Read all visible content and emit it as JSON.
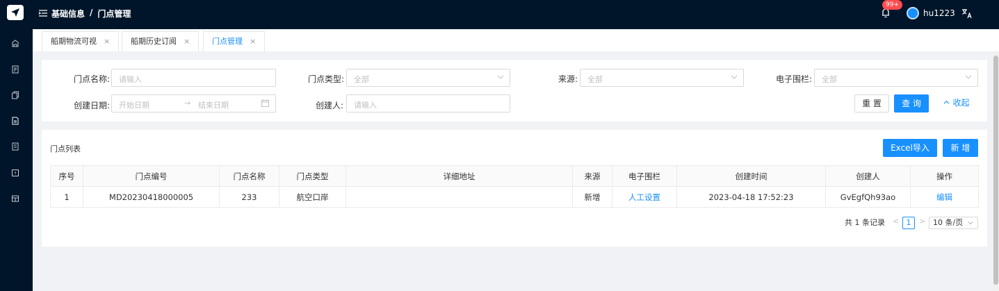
{
  "header": {
    "breadcrumb": [
      "基础信息",
      "门点管理"
    ],
    "breadcrumb_sep": "/",
    "badge": "99+",
    "username": "hu1223"
  },
  "tabs": [
    {
      "label": "船期物流可视",
      "close": "×"
    },
    {
      "label": "船期历史订阅",
      "close": "×"
    },
    {
      "label": "门点管理",
      "close": "×",
      "active": true
    }
  ],
  "filters": {
    "door_name": {
      "label": "门点名称:",
      "placeholder": "请输入"
    },
    "door_type": {
      "label": "门点类型:",
      "value": "全部"
    },
    "source": {
      "label": "来源:",
      "value": "全部"
    },
    "fence": {
      "label": "电子围栏:",
      "value": "全部"
    },
    "created_date": {
      "label": "创建日期:",
      "start": "开始日期",
      "sep": "→",
      "end": "结束日期"
    },
    "creator": {
      "label": "创建人:",
      "placeholder": "请输入"
    }
  },
  "actions": {
    "reset": "重 置",
    "query": "查 询",
    "collapse": "收起",
    "collapse_icon": "chevron-up-icon"
  },
  "list": {
    "title": "门点列表",
    "import_label": "Excel导入",
    "add_label": "新 增",
    "columns": [
      "序号",
      "门点编号",
      "门点名称",
      "门点类型",
      "详细地址",
      "来源",
      "电子围栏",
      "创建时间",
      "创建人",
      "操作"
    ],
    "rows": [
      [
        "1",
        "MD20230418000005",
        "233",
        "航空口岸",
        "",
        "新增",
        "人工设置",
        "2023-04-18 17:52:23",
        "GvEgfQh93ao",
        "编辑"
      ]
    ]
  },
  "pagination": {
    "total": "共 1 条记录",
    "prev": "<",
    "page": "1",
    "next": ">",
    "page_size": "10 条/页"
  },
  "colors": {
    "sidebar": "#001529",
    "primary": "#1890ff",
    "badge": "#ff4d4f"
  }
}
